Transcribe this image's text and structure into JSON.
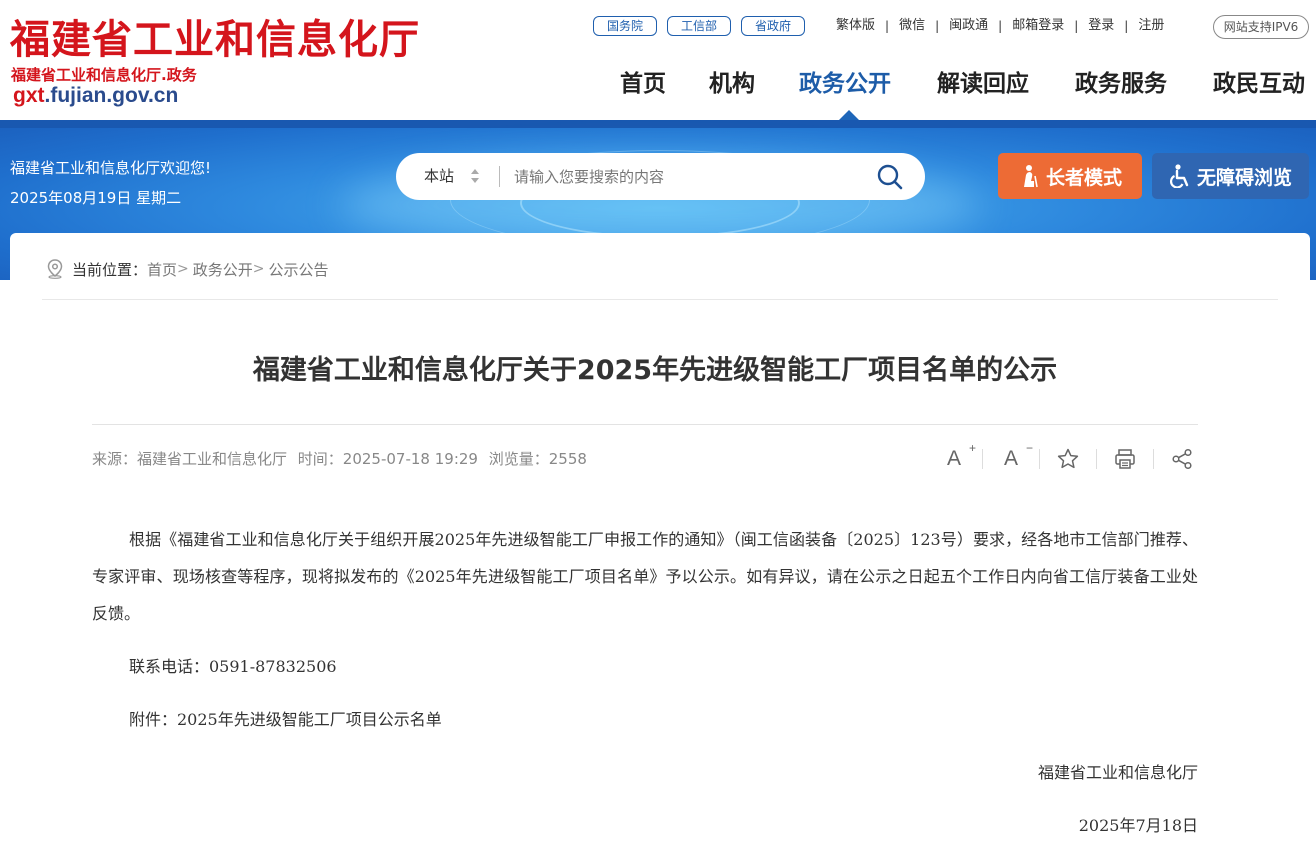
{
  "header": {
    "logo_title": "福建省工业和信息化厅",
    "logo_subtitle": "福建省工业和信息化厅.政务",
    "logo_domain_prefix": "gxt",
    "logo_domain_suffix": ".fujian.gov.cn",
    "top_pills": [
      "国务院",
      "工信部",
      "省政府"
    ],
    "util_links": [
      "繁体版",
      "微信",
      "闽政通",
      "邮箱登录",
      "登录",
      "注册"
    ],
    "ipv6_badge": "网站支持IPV6",
    "nav": [
      "首页",
      "机构",
      "政务公开",
      "解读回应",
      "政务服务",
      "政民互动"
    ],
    "nav_active": "政务公开"
  },
  "banner": {
    "welcome": "福建省工业和信息化厅欢迎您!",
    "date": "2025年08月19日 星期二",
    "search_scope": "本站",
    "search_placeholder": "请输入您要搜索的内容",
    "elder_mode": "长者模式",
    "accessible_browse": "无障碍浏览"
  },
  "breadcrumb": {
    "label": "当前位置：",
    "items": [
      "首页",
      "政务公开",
      "公示公告"
    ]
  },
  "article": {
    "title": "福建省工业和信息化厅关于2025年先进级智能工厂项目名单的公示",
    "source": "来源：福建省工业和信息化厅",
    "time": "时间：2025-07-18 19:29",
    "views": "浏览量：2558",
    "tools": {
      "font_larger": "A",
      "font_smaller": "A"
    },
    "paragraph": "根据《福建省工业和信息化厅关于组织开展2025年先进级智能工厂申报工作的通知》（闽工信函装备〔2025〕123号）要求，经各地市工信部门推荐、专家评审、现场核查等程序，现将拟发布的《2025年先进级智能工厂项目名单》予以公示。如有异议，请在公示之日起五个工作日内向省工信厅装备工业处反馈。",
    "contact": "联系电话：0591-87832506",
    "attachment": "附件：2025年先进级智能工厂项目公示名单",
    "signature": "福建省工业和信息化厅",
    "sign_date": "2025年7月18日"
  },
  "colors": {
    "brand_red": "#d4151c",
    "nav_blue": "#1d5ca8",
    "elder_orange": "#ed6b35",
    "access_blue": "#2f66b2",
    "banner_blue": "#2e89de"
  }
}
